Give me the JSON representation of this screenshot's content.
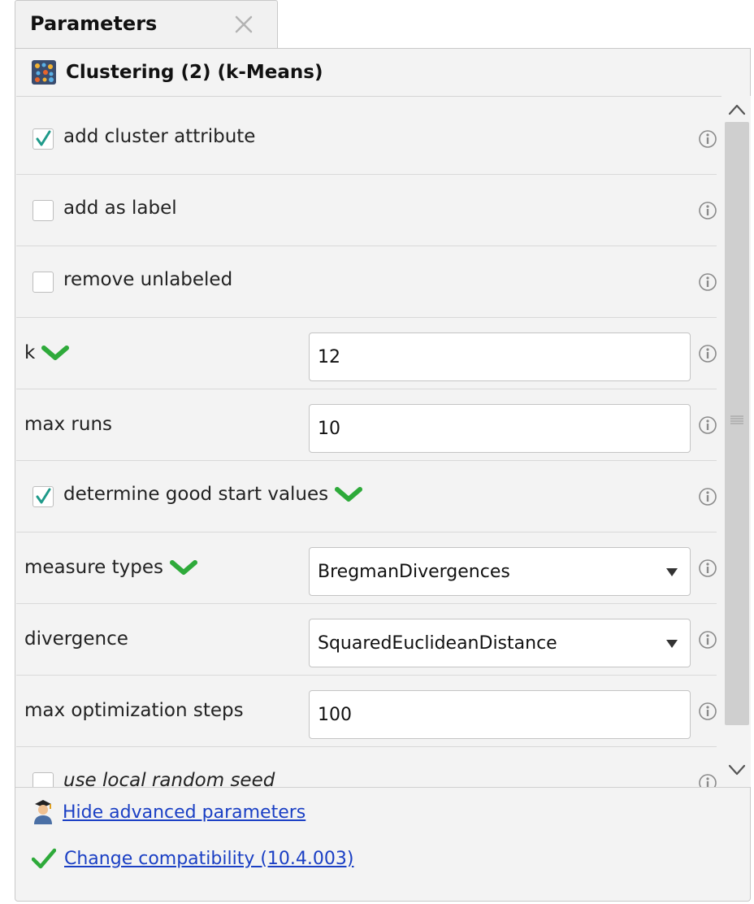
{
  "tab": {
    "title": "Parameters",
    "close_icon": "close-icon"
  },
  "operator": {
    "title": "Clustering (2) (k-Means)",
    "icon": "clustering-icon"
  },
  "params": {
    "add_cluster_attribute": {
      "label": "add cluster attribute",
      "checked": true
    },
    "add_as_label": {
      "label": "add as label",
      "checked": false
    },
    "remove_unlabeled": {
      "label": "remove unlabeled",
      "checked": false
    },
    "k": {
      "label": "k",
      "value": "12"
    },
    "max_runs": {
      "label": "max runs",
      "value": "10"
    },
    "determine_good_start_values": {
      "label": "determine good start values",
      "checked": true
    },
    "measure_types": {
      "label": "measure types",
      "value": "BregmanDivergences"
    },
    "divergence": {
      "label": "divergence",
      "value": "SquaredEuclideanDistance"
    },
    "max_optimization_steps": {
      "label": "max optimization steps",
      "value": "100"
    },
    "use_local_random_seed": {
      "label": "use local random seed",
      "checked": false
    }
  },
  "footer": {
    "hide_advanced": "Hide advanced parameters",
    "change_compat": "Change compatibility (10.4.003)"
  },
  "colors": {
    "link": "#1a3fc4",
    "check": "#1f9a8a",
    "green": "#2eaa3a"
  }
}
